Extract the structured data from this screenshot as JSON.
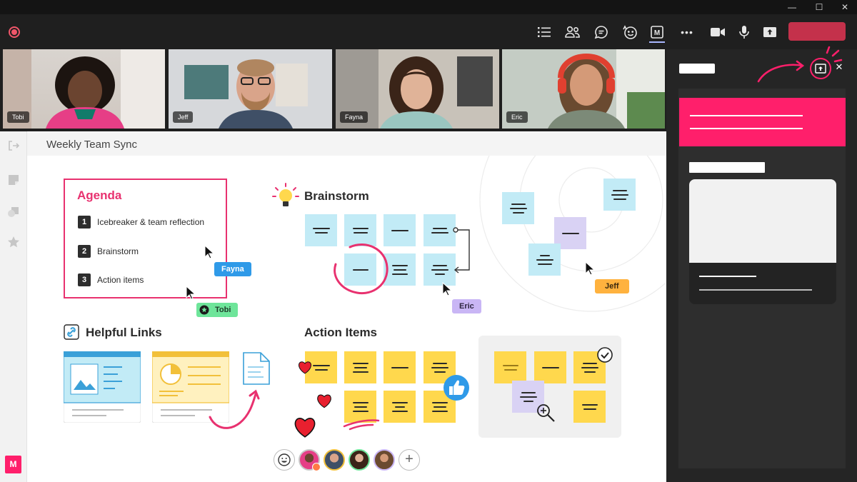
{
  "window": {
    "minimize": "—",
    "maximize": "☐",
    "close": "✕"
  },
  "toolbar": {
    "icons": [
      "list-icon",
      "people-icon",
      "chat-icon",
      "reactions-icon",
      "miro-app-icon",
      "more-icon",
      "camera-icon",
      "mic-icon",
      "share-icon"
    ],
    "more_label": "•••",
    "leave_color": "#c4314b"
  },
  "participants": [
    {
      "name": "Tobi"
    },
    {
      "name": "Jeff"
    },
    {
      "name": "Fayna"
    },
    {
      "name": "Eric"
    }
  ],
  "board": {
    "title": "Weekly Team Sync",
    "agenda": {
      "title": "Agenda",
      "items": [
        {
          "num": "1",
          "label": "Icebreaker & team reflection"
        },
        {
          "num": "2",
          "label": "Brainstorm"
        },
        {
          "num": "3",
          "label": "Action items"
        }
      ]
    },
    "brainstorm_title": "Brainstorm",
    "links_title": "Helpful Links",
    "action_title": "Action Items",
    "cursors": {
      "fayna": "Fayna",
      "tobi": "Tobi",
      "eric": "Eric",
      "jeff": "Jeff"
    },
    "logo": "M"
  },
  "colors": {
    "accent_pink": "#ff1f6b",
    "agenda_pink": "#e8316f",
    "sticky_blue": "#c2ebf6",
    "sticky_yellow": "#ffd84d",
    "sticky_purple": "#d9d2f4",
    "fayna_label": "#2f9ae8",
    "tobi_label": "#6ee59a",
    "eric_label": "#c9b6f5",
    "jeff_label": "#ffb23e"
  }
}
